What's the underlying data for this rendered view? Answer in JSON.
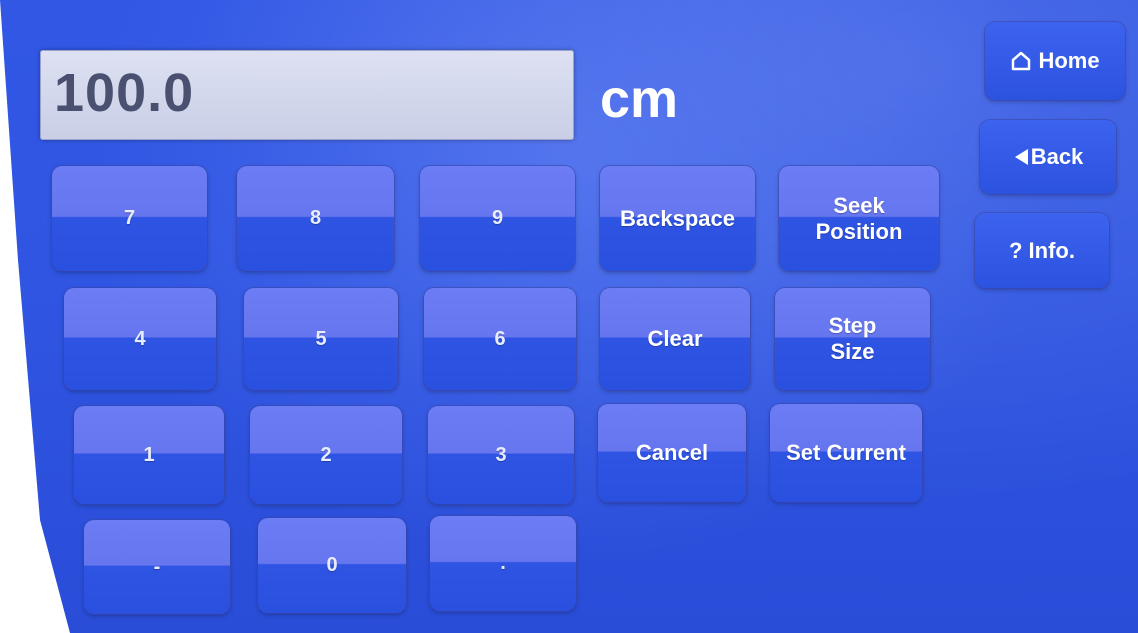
{
  "entry": {
    "value": "100.0",
    "unit": "cm"
  },
  "keypad": {
    "k7": "7",
    "k8": "8",
    "k9": "9",
    "k4": "4",
    "k5": "5",
    "k6": "6",
    "k1": "1",
    "k2": "2",
    "k3": "3",
    "kminus": "-",
    "k0": "0",
    "kdot": "."
  },
  "actions": {
    "backspace": "Backspace",
    "seek_position": "Seek\nPosition",
    "clear": "Clear",
    "step_size": "Step\nSize",
    "cancel": "Cancel",
    "set_current": "Set Current"
  },
  "nav": {
    "home": "Home",
    "back": "Back",
    "info": "? Info.",
    "home_icon": "house-outline-icon",
    "back_icon": "left-triangle-icon"
  },
  "colors": {
    "screen_bg": "#2f55e2",
    "key_top": "#6c7cf4",
    "key_bottom": "#2f54e3",
    "field_bg": "#dde1f2",
    "value_text": "#4a5070"
  }
}
